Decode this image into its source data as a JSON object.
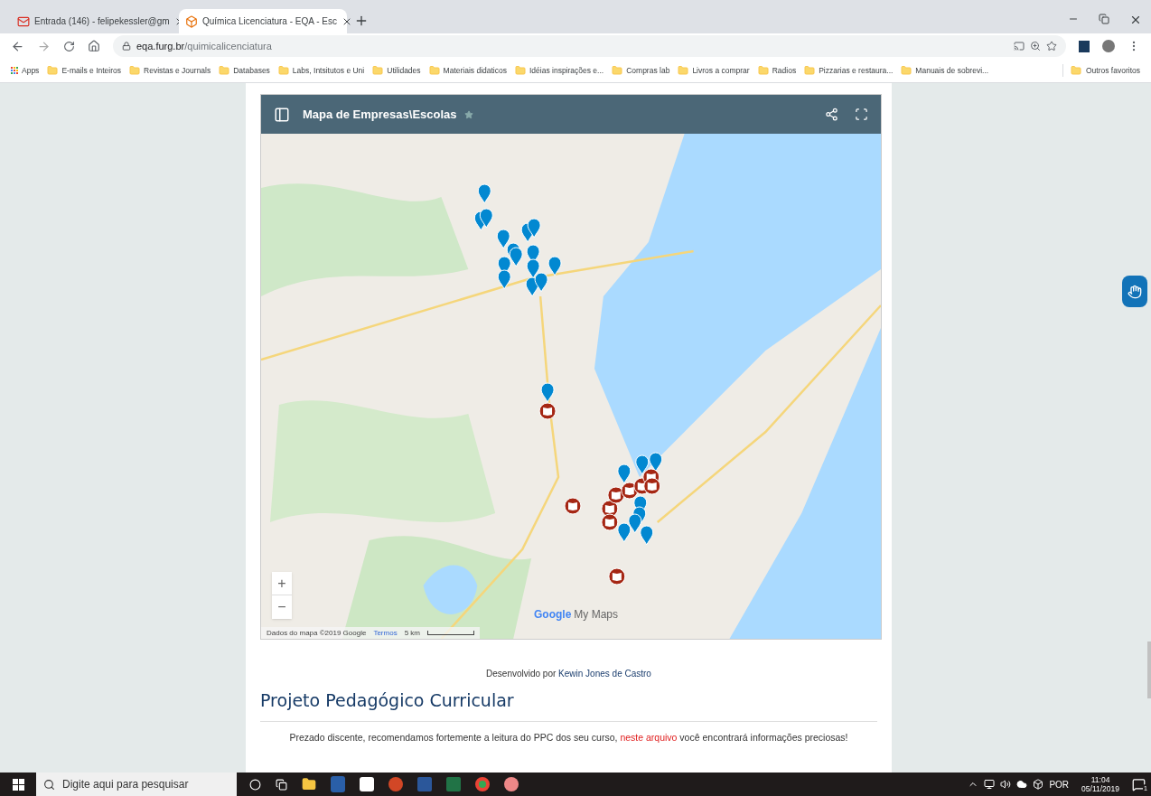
{
  "browser": {
    "tabs": [
      {
        "title": "Entrada (146) - felipekessler@gm",
        "selected": false
      },
      {
        "title": "Química Licenciatura - EQA - Esc",
        "selected": true
      }
    ],
    "address": {
      "domain": "eqa.furg.br",
      "path": "/quimicalicenciatura"
    },
    "bookmarks": [
      {
        "label": "Apps",
        "kind": "apps"
      },
      {
        "label": "E-mails e Inteiros",
        "kind": "folder"
      },
      {
        "label": "Revistas e Journals",
        "kind": "folder"
      },
      {
        "label": "Databases",
        "kind": "folder"
      },
      {
        "label": "Labs, Intsitutos e Uni",
        "kind": "folder"
      },
      {
        "label": "Utilidades",
        "kind": "folder"
      },
      {
        "label": "Materiais didaticos",
        "kind": "folder"
      },
      {
        "label": "Idéias inspirações e...",
        "kind": "folder"
      },
      {
        "label": "Compras lab",
        "kind": "folder"
      },
      {
        "label": "Livros a comprar",
        "kind": "folder"
      },
      {
        "label": "Radios",
        "kind": "folder"
      },
      {
        "label": "Pizzarias e restaura...",
        "kind": "folder"
      },
      {
        "label": "Manuais de sobrevi...",
        "kind": "folder"
      }
    ],
    "other_bookmarks": "Outros favoritos"
  },
  "map": {
    "title": "Mapa de Empresas\\Escolas",
    "zoom_in": "+",
    "zoom_out": "−",
    "brand": "Google",
    "brand_suffix": "My Maps",
    "attribution": "Dados do mapa ©2019 Google",
    "terms_link": "Termos",
    "scale": "5 km"
  },
  "credit": {
    "prefix": "Desenvolvido por",
    "author": "Kewin Jones de Castro"
  },
  "section": {
    "title": "Projeto Pedagógico Curricular",
    "text_before": "Prezado discente, recomendamos fortemente a leitura do PPC dos seu curso,",
    "link": "neste arquivo",
    "text_after": "você encontrará informações preciosas!"
  },
  "taskbar": {
    "search_placeholder": "Digite aqui para pesquisar",
    "language": "POR",
    "time": "11:04",
    "date": "05/11/2019",
    "notifications": "1"
  }
}
